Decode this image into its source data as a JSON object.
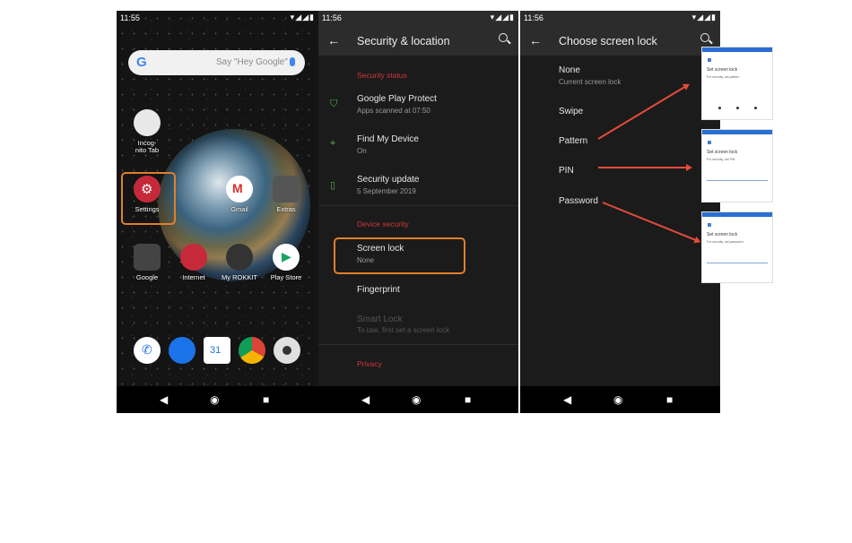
{
  "panel1": {
    "time": "11:55",
    "search_placeholder": "Say \"Hey Google\"",
    "search_logo": "G",
    "apps": [
      {
        "label": "Incog-\nnito Tab"
      },
      {
        "label": "Settings"
      },
      {
        "label": "Gmail"
      },
      {
        "label": "Extras"
      },
      {
        "label": "Google"
      },
      {
        "label": "Internet"
      },
      {
        "label": "My ROKKIT"
      },
      {
        "label": "Play Store"
      }
    ],
    "dock_calendar": "31"
  },
  "panel2": {
    "time": "11:56",
    "title": "Security & location",
    "section_status": "Security status",
    "rows": [
      {
        "title": "Google Play Protect",
        "subtitle": "Apps scanned at 07:50"
      },
      {
        "title": "Find My Device",
        "subtitle": "On"
      },
      {
        "title": "Security update",
        "subtitle": "5 September 2019"
      }
    ],
    "section_device": "Device security",
    "screen_lock": {
      "title": "Screen lock",
      "subtitle": "None"
    },
    "fingerprint": "Fingerprint",
    "smart_lock": {
      "title": "Smart Lock",
      "subtitle": "To use, first set a screen lock"
    },
    "section_privacy": "Privacy"
  },
  "panel3": {
    "time": "11:56",
    "title": "Choose screen lock",
    "options": [
      {
        "title": "None",
        "subtitle": "Current screen lock"
      },
      {
        "title": "Swipe"
      },
      {
        "title": "Pattern"
      },
      {
        "title": "PIN"
      },
      {
        "title": "Password"
      }
    ]
  },
  "thumbs": [
    {
      "title": "Set screen lock",
      "subtitle": "For security, set pattern"
    },
    {
      "title": "Set screen lock",
      "subtitle": "For security, set PIN"
    },
    {
      "title": "Set screen lock",
      "subtitle": "For security, set password"
    }
  ],
  "colors": {
    "accent_red": "#d0363f",
    "highlight_orange": "#e0802a",
    "arrow_red": "#e44b3a"
  }
}
